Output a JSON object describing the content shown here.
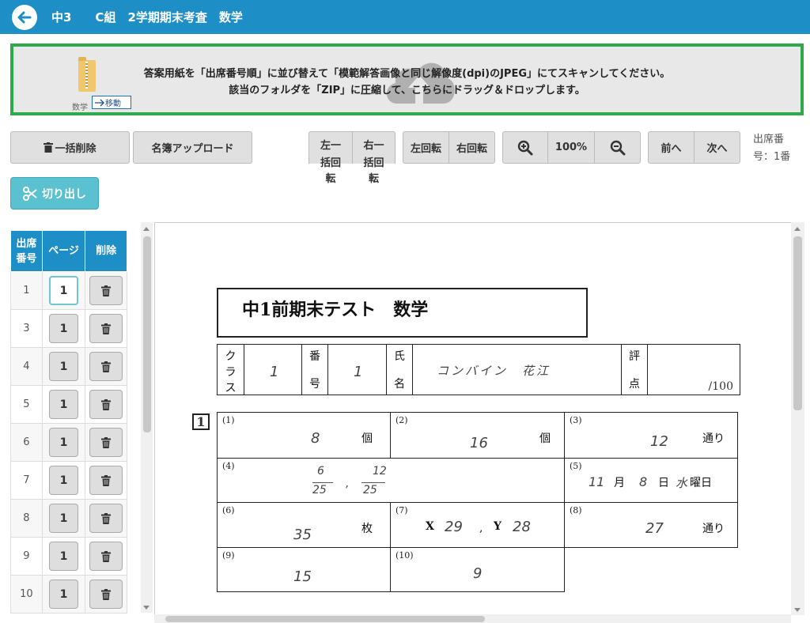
{
  "header": {
    "title": "中3　　C組　2学期期末考査　数学"
  },
  "upload": {
    "line1": "答案用紙を「出席番号順」に並び替えて「模範解答画像と同じ解像度(dpi)のJPEG」にてスキャンしてください。",
    "line2": "該当のフォルダを「ZIP」に圧縮して、こちらにドラッグ＆ドロップします。",
    "folder_label": "数学",
    "move_label": "移動"
  },
  "toolbar": {
    "bulk_delete": "一括削除",
    "roster_upload": "名簿アップロード",
    "left_bulk_rotate": [
      "左一",
      "括回",
      "転"
    ],
    "right_bulk_rotate": [
      "右一",
      "括回",
      "転"
    ],
    "rotate_left": "左回転",
    "rotate_right": "右回転",
    "zoom_level": "100%",
    "prev": "前へ",
    "next": "次へ",
    "attendance_info": "出席番号：1番",
    "cut_out": "切り出し"
  },
  "table": {
    "headers": [
      "出席番号",
      "ページ",
      "削除"
    ],
    "rows": [
      {
        "number": "1",
        "page": "1"
      },
      {
        "number": "3",
        "page": "1"
      },
      {
        "number": "4",
        "page": "1"
      },
      {
        "number": "5",
        "page": "1"
      },
      {
        "number": "6",
        "page": "1"
      },
      {
        "number": "7",
        "page": "1"
      },
      {
        "number": "8",
        "page": "1"
      },
      {
        "number": "9",
        "page": "1"
      },
      {
        "number": "10",
        "page": "1"
      }
    ]
  },
  "exam": {
    "title": "中1前期末テスト　数学",
    "class_label": [
      "ク",
      "ラ",
      "ス"
    ],
    "class_value": "1",
    "number_label": [
      "番",
      "号"
    ],
    "number_value": "1",
    "name_label": [
      "氏",
      "名"
    ],
    "name_value": "コンバイン　花江",
    "score_label": [
      "評",
      "点"
    ],
    "score_total": "/100",
    "question_number": "1",
    "answers": [
      {
        "label": "(1)",
        "value": "8",
        "unit": "個"
      },
      {
        "label": "(2)",
        "value": "16",
        "unit": "個"
      },
      {
        "label": "(3)",
        "value": "12",
        "unit": "通り"
      },
      {
        "label": "(4)",
        "value_a_num": "6",
        "value_a_den": "25",
        "sep": ",",
        "value_b_num": "12",
        "value_b_den": "25"
      },
      {
        "label": "(5)",
        "month": "11",
        "month_unit": "月",
        "day": "8",
        "day_unit": "日",
        "weekday": "水",
        "weekday_unit": "曜日"
      },
      {
        "label": "(6)",
        "value": "35",
        "unit": "枚"
      },
      {
        "label": "(7)",
        "x_label": "X",
        "x_value": "29",
        "sep": ",",
        "y_label": "Y",
        "y_value": "28"
      },
      {
        "label": "(8)",
        "value": "27",
        "unit": "通り"
      },
      {
        "label": "(9)",
        "value": "15"
      },
      {
        "label": "(10)",
        "value": "9"
      }
    ]
  },
  "colors": {
    "header_bg": "#1e8fc6",
    "upload_border": "#2eaa4a",
    "cut_button": "#5bc0cf"
  }
}
